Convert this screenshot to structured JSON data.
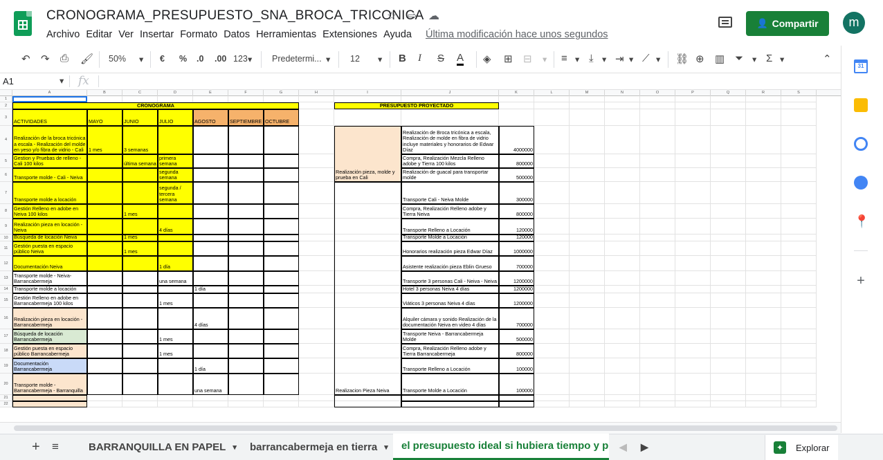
{
  "doc": {
    "title": "CRONOGRAMA_PRESUPUESTO_SNA_BROCA_TRICONICA",
    "menu": [
      "Archivo",
      "Editar",
      "Ver",
      "Insertar",
      "Formato",
      "Datos",
      "Herramientas",
      "Extensiones",
      "Ayuda"
    ],
    "last_modified": "Última modificación hace unos segundos",
    "share_label": "Compartir",
    "avatar_letter": "m"
  },
  "toolbar": {
    "zoom": "50%",
    "currency": "€",
    "percent": "%",
    "dec_less": ".0",
    "dec_more": ".00",
    "format_more": "123",
    "font": "Predetermi...",
    "font_size": "12",
    "bold": "B",
    "italic": "I",
    "strike": "S",
    "text_color": "A"
  },
  "formula": {
    "cell": "A1",
    "fx": "fx"
  },
  "columns": [
    "A",
    "B",
    "C",
    "D",
    "E",
    "F",
    "G",
    "H",
    "I",
    "J",
    "K",
    "L",
    "M",
    "N",
    "O",
    "P",
    "Q",
    "R",
    "S"
  ],
  "rows": [
    "1",
    "2",
    "3",
    "4",
    "5",
    "6",
    "7",
    "8",
    "9",
    "10",
    "11",
    "12",
    "13",
    "14",
    "15",
    "16",
    "17",
    "18",
    "19",
    "20",
    "21",
    "22"
  ],
  "cronograma": {
    "title": "CRONOGRAMA",
    "headers": [
      "ACTIVIDADES",
      "MAYO",
      "JUNIO",
      "JULIO",
      "AGOSTO",
      "SEPTIEMBRE",
      "OCTUBRE"
    ],
    "activities": [
      "Realización de la broca tricónica a escala - Realización del molde en yeso y/o fibra de vidrio - Cali",
      "Gestion y Pruebas de relleno - Cali 100 kilos",
      "Transporte molde - Cali - Neiva",
      "Transporte molde a locación",
      "Gestión Relleno en adobe en Neiva 100 kilos",
      "Realización pieza en locación - Neiva",
      "Búsqueda de locación Neiva",
      "Gestión puesta en espacio público Neiva",
      "Documentación Neiva",
      "Transporte molde - Neiva-Barrancabermeja",
      "Transporte molde a locación",
      "Gestión Relleno en adobe en Barrancabermeja 100 kilos",
      "Realización pieza en locación - Barrancabermeja",
      "Búsqueda de locación Barrancabermeja",
      "Gestión puesta en espacio público Barrancabermeja",
      "Documentación Barrancabermeja",
      "Transporte molde - Barrancabermeja - Barranquilla"
    ],
    "cells": {
      "r4_mayo": "1 mes",
      "r4_junio": "3 semanas",
      "r5_junio": "última semana",
      "r5_julio": "primera semana",
      "r6_julio": "segunda semana",
      "r7_julio": "segunda / tercera semana",
      "r8_junio": "1 mes",
      "r9_julio": "4 días",
      "r10_junio": "1 mes",
      "r11_junio": "1 mes",
      "r12_julio": "1 día",
      "r13_julio": "una semana",
      "r14_agosto": "1 día",
      "r15_julio": "1 mes",
      "r16_agosto": "4 días",
      "r17_julio": "1 mes",
      "r18_julio": "1 mes",
      "r19_agosto": "1 día",
      "r20_agosto": "una semana"
    }
  },
  "presupuesto": {
    "title": "PRESUPUESTO PROYECTADO",
    "group1": "Realización pieza, molde y prueba en Cali",
    "group2": "Realizacion Pieza Neiva",
    "items": [
      {
        "desc": "Realización de Broca tricónica a escala, Realización de molde en fibra de vidrio incluye materiales y honorarios de Edwar Díaz",
        "value": "4000000"
      },
      {
        "desc": "Compra, Realización Mezcla Relleno adobe y Tierra 100 kilos",
        "value": "800000"
      },
      {
        "desc": "Realización de guacal para transportar molde",
        "value": "500000"
      },
      {
        "desc": "Transporte Cali - Neiva Molde",
        "value": "300000"
      },
      {
        "desc": "Compra, Realización Relleno adobe y Tierra Neiva",
        "value": "800000"
      },
      {
        "desc": "Transporte Relleno a Locación",
        "value": "120000"
      },
      {
        "desc": "Transporte Molde a Locación",
        "value": "120000"
      },
      {
        "desc": "Honorarios realización pieza Edwar Díaz",
        "value": "1000000"
      },
      {
        "desc": "Asistente realización pieza Eblin Grueso",
        "value": "700000"
      },
      {
        "desc": "Transporte 3 personas Cali - Neiva - Neiva",
        "value": "1200000"
      },
      {
        "desc": "Hotel 3 personas Neiva 4 días",
        "value": "1200000"
      },
      {
        "desc": "Viáticos 3 personas Neiva 4 días",
        "value": "1200000"
      },
      {
        "desc": "Alquiler cámara y sonido Realización de la documentación Neiva en video 4 días",
        "value": "700000"
      },
      {
        "desc": "Transporte Neiva - Barrancabermeja Molde",
        "value": "500000"
      },
      {
        "desc": "Compra, Realización Relleno adobe y Tierra Barrancabermeja",
        "value": "800000"
      },
      {
        "desc": "Transporte Relleno a Locación",
        "value": "100000"
      },
      {
        "desc": "Transporte Molde a Locación",
        "value": "100000"
      }
    ]
  },
  "tabs": {
    "tab1": "BARRANQUILLA EN PAPEL",
    "tab2": "barrancabermeja en tierra",
    "tab3": "el presupuesto ideal si hubiera tiempo y p",
    "explore": "Explorar"
  }
}
